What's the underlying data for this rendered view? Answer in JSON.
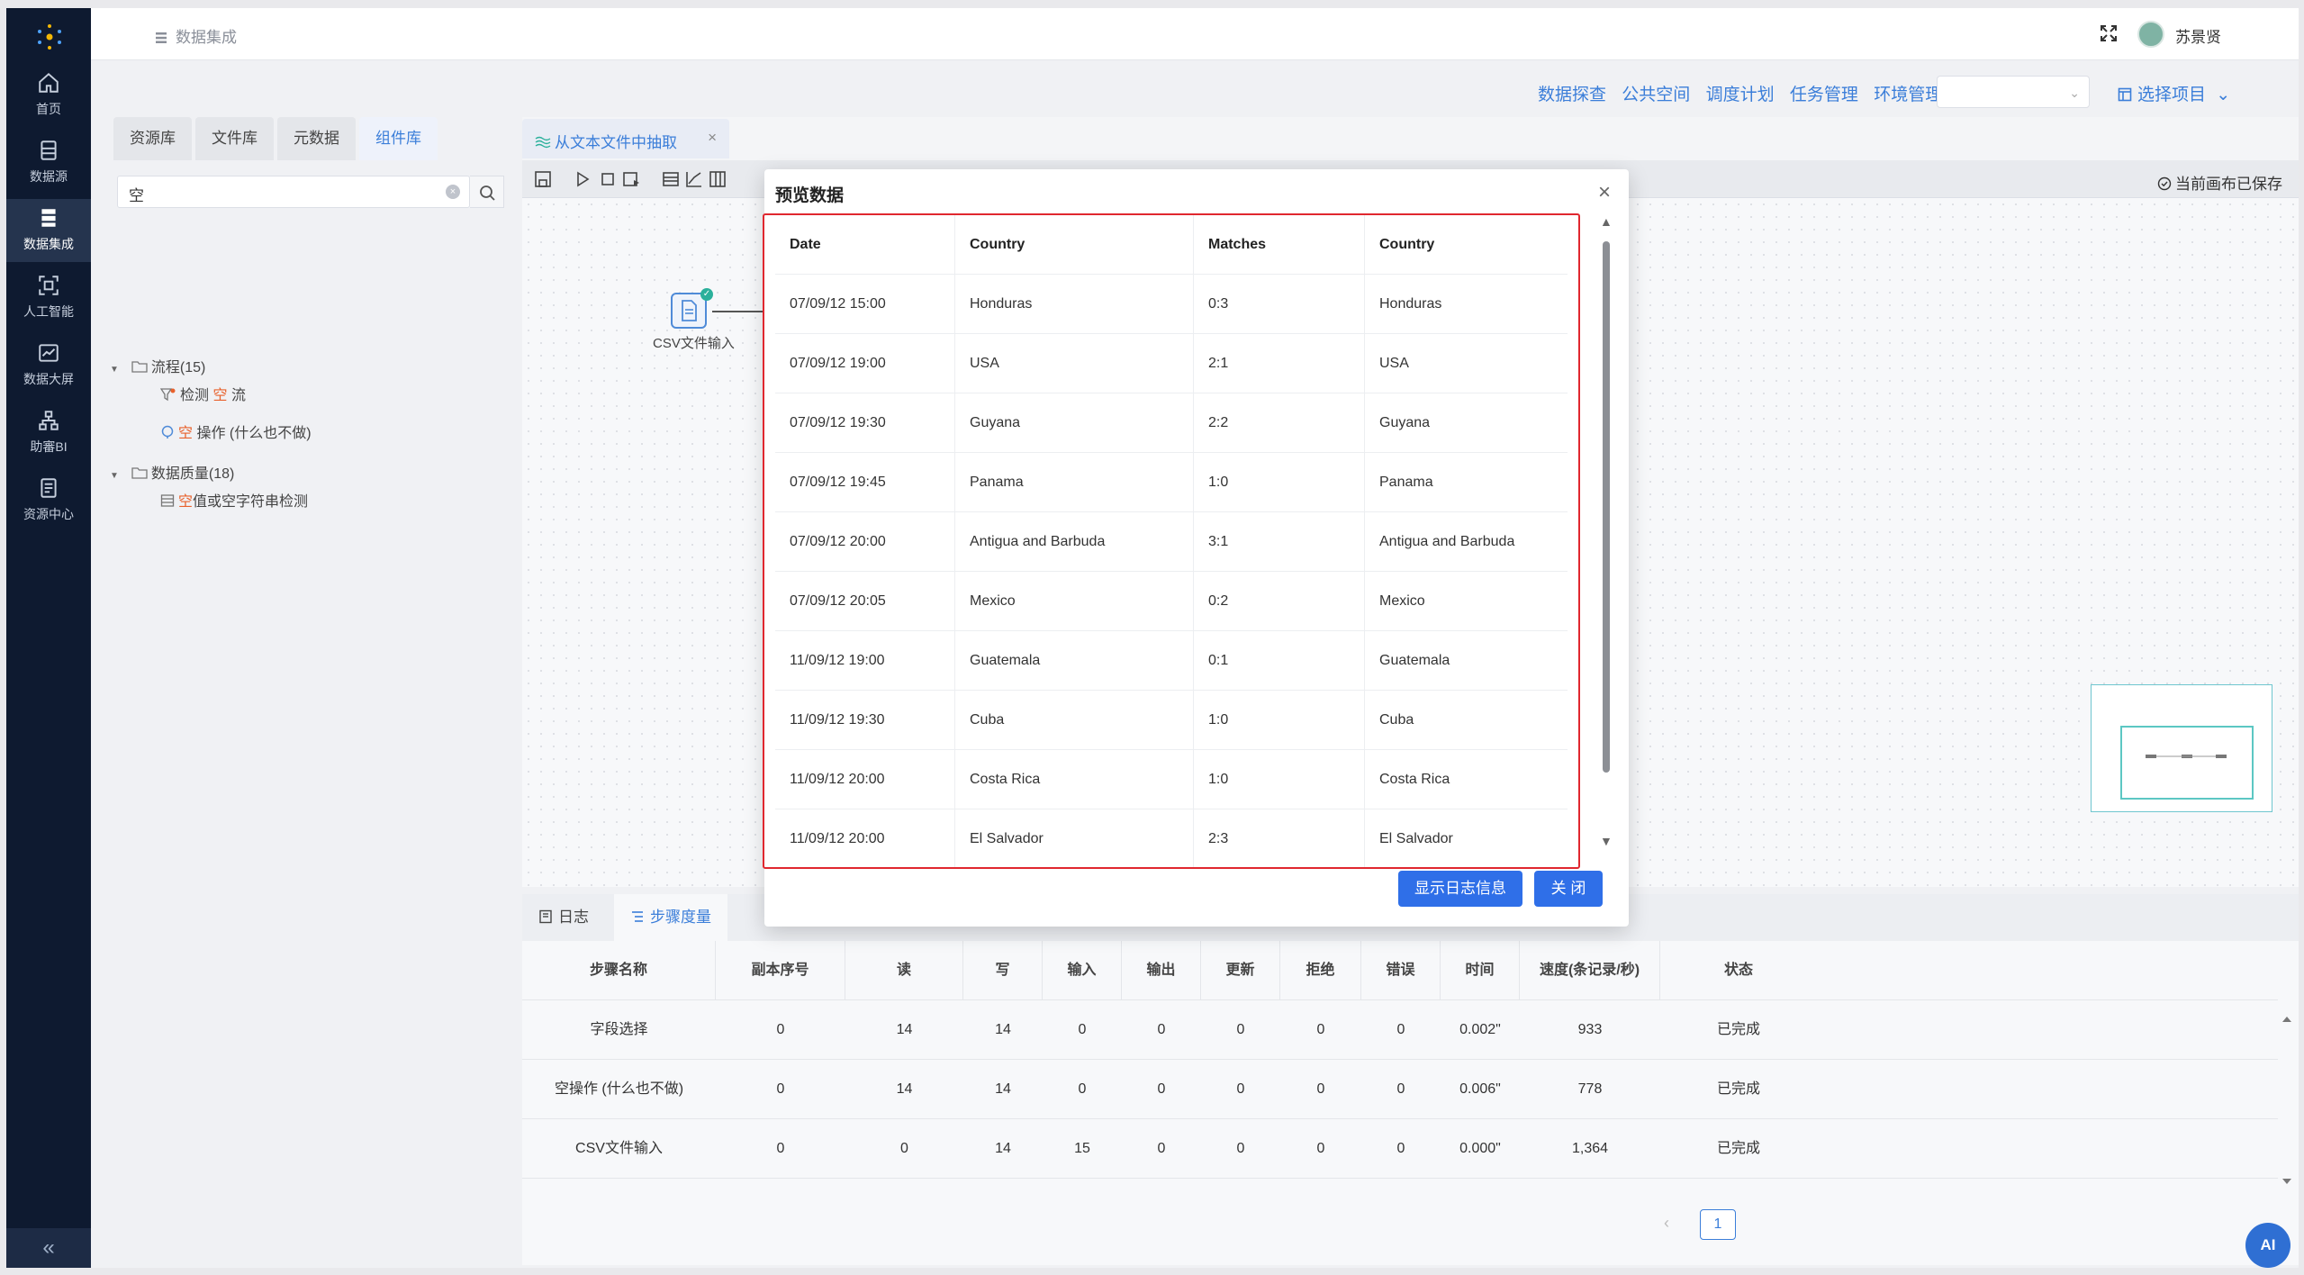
{
  "app": {
    "breadcrumb": "数据集成",
    "username": "苏景贤"
  },
  "nav": {
    "items": [
      {
        "label": "首页",
        "icon": "home-icon"
      },
      {
        "label": "数据源",
        "icon": "database-icon"
      },
      {
        "label": "数据集成",
        "icon": "integration-icon",
        "active": true
      },
      {
        "label": "人工智能",
        "icon": "ai-scan-icon"
      },
      {
        "label": "数据大屏",
        "icon": "chart-screen-icon"
      },
      {
        "label": "助審BI",
        "icon": "org-tree-icon"
      },
      {
        "label": "资源中心",
        "icon": "resource-icon"
      }
    ],
    "collapse": "«"
  },
  "subnav": {
    "items": [
      "数据探查",
      "公共空间",
      "调度计划",
      "任务管理",
      "环境管理"
    ],
    "env_select_value": "",
    "project_select": "选择项目"
  },
  "left_panel": {
    "tabs": [
      "资源库",
      "文件库",
      "元数据",
      "组件库"
    ],
    "active_tab": "组件库",
    "search_value": "空",
    "tree": {
      "group1": "流程(15)",
      "group1_item1_pre": "检测",
      "group1_item1_hl": "空",
      "group1_item1_post": "流",
      "group1_item2_hl": "空",
      "group1_item2_post": "操作 (什么也不做)",
      "group2": "数据质量(18)",
      "group2_item1_hl": "空",
      "group2_item1_post": "值或空字符串检测"
    }
  },
  "editor": {
    "tab_label": "从文本文件中抽取",
    "saved_status": "当前画布已保存",
    "node_label": "CSV文件输入"
  },
  "modal": {
    "title": "预览数据",
    "headers": [
      "Date",
      "Country",
      "Matches",
      "Country"
    ],
    "rows": [
      [
        "07/09/12 15:00",
        "Honduras",
        "0:3",
        "Honduras"
      ],
      [
        "07/09/12 19:00",
        "USA",
        "2:1",
        "USA"
      ],
      [
        "07/09/12 19:30",
        "Guyana",
        "2:2",
        "Guyana"
      ],
      [
        "07/09/12 19:45",
        "Panama",
        "1:0",
        "Panama"
      ],
      [
        "07/09/12 20:00",
        "Antigua and Barbuda",
        "3:1",
        "Antigua and Barbuda"
      ],
      [
        "07/09/12 20:05",
        "Mexico",
        "0:2",
        "Mexico"
      ],
      [
        "11/09/12 19:00",
        "Guatemala",
        "0:1",
        "Guatemala"
      ],
      [
        "11/09/12 19:30",
        "Cuba",
        "1:0",
        "Cuba"
      ],
      [
        "11/09/12 20:00",
        "Costa Rica",
        "1:0",
        "Costa Rica"
      ],
      [
        "11/09/12 20:00",
        "El Salvador",
        "2:3",
        "El Salvador"
      ]
    ],
    "show_log_button": "显示日志信息",
    "close_button": "关 闭"
  },
  "bottom": {
    "tabs": [
      "日志",
      "步骤度量"
    ],
    "active_tab": "步骤度量",
    "headers": [
      "步骤名称",
      "副本序号",
      "读",
      "写",
      "输入",
      "输出",
      "更新",
      "拒绝",
      "错误",
      "时间",
      "速度(条记录/秒)",
      "状态"
    ],
    "rows": [
      [
        "字段选择",
        "0",
        "14",
        "14",
        "0",
        "0",
        "0",
        "0",
        "0",
        "0.002\"",
        "933",
        "已完成"
      ],
      [
        "空操作 (什么也不做)",
        "0",
        "14",
        "14",
        "0",
        "0",
        "0",
        "0",
        "0",
        "0.006\"",
        "778",
        "已完成"
      ],
      [
        "CSV文件输入",
        "0",
        "0",
        "14",
        "15",
        "0",
        "0",
        "0",
        "0",
        "0.000\"",
        "1,364",
        "已完成"
      ]
    ],
    "page": "1",
    "ai_label": "AI"
  },
  "colors": {
    "accent": "#3b7ed9",
    "nav_bg": "#0e1a30",
    "highlight": "#e0272f",
    "button": "#2f6fe8"
  }
}
